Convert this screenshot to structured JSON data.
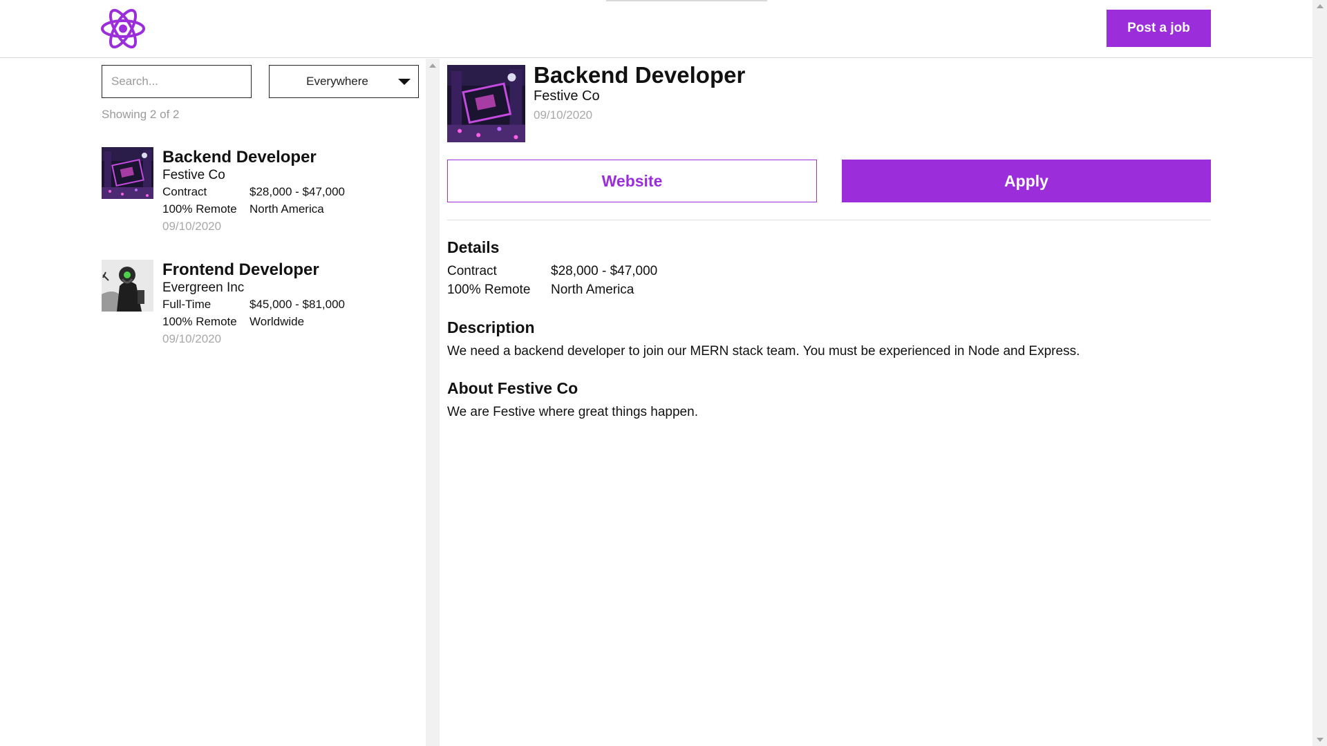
{
  "header": {
    "post_job_label": "Post a job",
    "brand_color": "#9b2ddb"
  },
  "search": {
    "placeholder": "Search...",
    "value": ""
  },
  "location_filter": {
    "selected": "Everywhere"
  },
  "list": {
    "showing_text": "Showing 2 of 2",
    "jobs": [
      {
        "title": "Backend Developer",
        "company": "Festive Co",
        "type": "Contract",
        "salary": "$28,000 - $47,000",
        "remote": "100% Remote",
        "region": "North America",
        "date": "09/10/2020",
        "thumbnail": "neon-city-thumbnail"
      },
      {
        "title": "Frontend Developer",
        "company": "Evergreen Inc",
        "type": "Full-Time",
        "salary": "$45,000 - $81,000",
        "remote": "100% Remote",
        "region": "Worldwide",
        "date": "09/10/2020",
        "thumbnail": "gas-mask-figure-thumbnail"
      }
    ]
  },
  "detail": {
    "title": "Backend Developer",
    "company": "Festive Co",
    "date": "09/10/2020",
    "website_label": "Website",
    "apply_label": "Apply",
    "details_heading": "Details",
    "details": {
      "type": "Contract",
      "salary": "$28,000 - $47,000",
      "remote": "100% Remote",
      "region": "North America"
    },
    "description_heading": "Description",
    "description": "We need a backend developer to join our MERN stack team. You must be experienced in Node and Express.",
    "about_heading": "About Festive Co",
    "about": "We are Festive where great things happen."
  }
}
